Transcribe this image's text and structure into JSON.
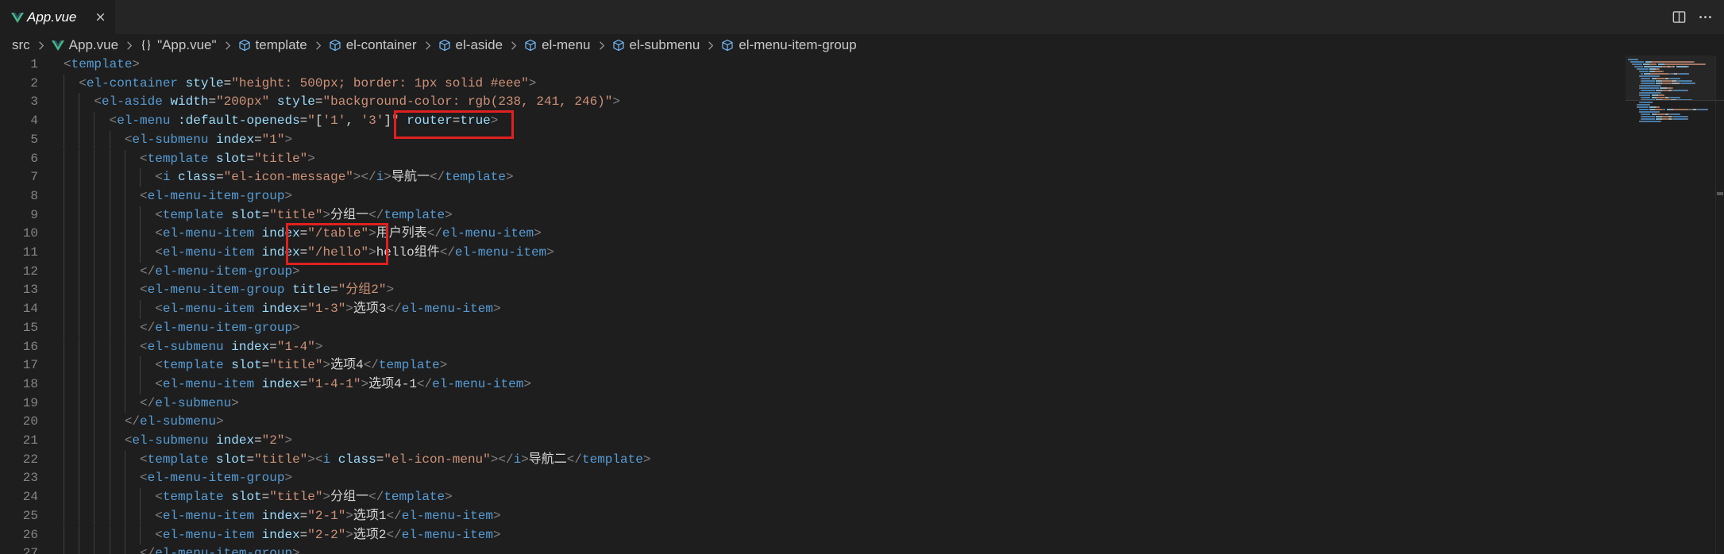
{
  "tabs": [
    {
      "label": "App.vue",
      "icon": "vue-icon"
    }
  ],
  "tab_actions": {
    "close_icon": "close-icon",
    "split_icon": "split-editor-icon",
    "more_icon": "more-actions-icon"
  },
  "breadcrumb_separator_icon": "chevron-right-icon",
  "breadcrumbs": [
    {
      "label": "src"
    },
    {
      "label": "App.vue",
      "icon": "vue-icon"
    },
    {
      "label": "\"App.vue\"",
      "icon": "braces-icon"
    },
    {
      "label": "template",
      "icon": "element-icon"
    },
    {
      "label": "el-container",
      "icon": "element-icon"
    },
    {
      "label": "el-aside",
      "icon": "element-icon"
    },
    {
      "label": "el-menu",
      "icon": "element-icon"
    },
    {
      "label": "el-submenu",
      "icon": "element-icon"
    },
    {
      "label": "el-menu-item-group",
      "icon": "element-icon"
    }
  ],
  "colors": {
    "editor_background": "#1e1e1e",
    "punctuation": "#808080",
    "tag": "#569cd6",
    "attribute": "#9cdcfe",
    "string": "#ce9178",
    "text": "#d4d4d4",
    "line_number": "#858585",
    "annotation": "#e02020",
    "vue_green": "#41b883",
    "element_icon": "#75beff"
  },
  "editor": {
    "lines": [
      {
        "number": "1",
        "tokens": [
          [
            "<",
            "punct"
          ],
          [
            "template",
            "tag"
          ],
          [
            ">",
            "punct"
          ]
        ]
      },
      {
        "number": "2",
        "tokens": [
          [
            "  ",
            "indent"
          ],
          [
            "<",
            "punct"
          ],
          [
            "el-container",
            "tag"
          ],
          [
            " ",
            "text"
          ],
          [
            "style",
            "attr"
          ],
          [
            "=",
            "text"
          ],
          [
            "\"height: 500px; border: 1px solid #eee\"",
            "str"
          ],
          [
            ">",
            "punct"
          ]
        ]
      },
      {
        "number": "3",
        "tokens": [
          [
            "    ",
            "indent"
          ],
          [
            "<",
            "punct"
          ],
          [
            "el-aside",
            "tag"
          ],
          [
            " ",
            "text"
          ],
          [
            "width",
            "attr"
          ],
          [
            "=",
            "text"
          ],
          [
            "\"200px\"",
            "str"
          ],
          [
            " ",
            "text"
          ],
          [
            "style",
            "attr"
          ],
          [
            "=",
            "text"
          ],
          [
            "\"background-color: rgb(238, 241, 246)\"",
            "str"
          ],
          [
            ">",
            "punct"
          ]
        ]
      },
      {
        "number": "4",
        "tokens": [
          [
            "      ",
            "indent"
          ],
          [
            "<",
            "punct"
          ],
          [
            "el-menu",
            "tag"
          ],
          [
            " ",
            "text"
          ],
          [
            ":default-openeds",
            "attr"
          ],
          [
            "=",
            "text"
          ],
          [
            "\"",
            "str"
          ],
          [
            "[",
            "text"
          ],
          [
            "'1'",
            "str"
          ],
          [
            ", ",
            "text"
          ],
          [
            "'3'",
            "str"
          ],
          [
            "]",
            "text"
          ],
          [
            "\"",
            "str"
          ],
          [
            " ",
            "text"
          ],
          [
            "router",
            "attr"
          ],
          [
            "=",
            "text"
          ],
          [
            "true",
            "attr"
          ],
          [
            ">",
            "punct"
          ]
        ]
      },
      {
        "number": "5",
        "tokens": [
          [
            "        ",
            "indent"
          ],
          [
            "<",
            "punct"
          ],
          [
            "el-submenu",
            "tag"
          ],
          [
            " ",
            "text"
          ],
          [
            "index",
            "attr"
          ],
          [
            "=",
            "text"
          ],
          [
            "\"1\"",
            "str"
          ],
          [
            ">",
            "punct"
          ]
        ]
      },
      {
        "number": "6",
        "tokens": [
          [
            "          ",
            "indent"
          ],
          [
            "<",
            "punct"
          ],
          [
            "template",
            "tag"
          ],
          [
            " ",
            "text"
          ],
          [
            "slot",
            "attr"
          ],
          [
            "=",
            "text"
          ],
          [
            "\"title\"",
            "str"
          ],
          [
            ">",
            "punct"
          ]
        ]
      },
      {
        "number": "7",
        "tokens": [
          [
            "            ",
            "indent"
          ],
          [
            "<",
            "punct"
          ],
          [
            "i",
            "tag"
          ],
          [
            " ",
            "text"
          ],
          [
            "class",
            "attr"
          ],
          [
            "=",
            "text"
          ],
          [
            "\"el-icon-message\"",
            "str"
          ],
          [
            "></",
            "punct"
          ],
          [
            "i",
            "tag"
          ],
          [
            ">",
            "punct"
          ],
          [
            "导航一",
            "text"
          ],
          [
            "</",
            "punct"
          ],
          [
            "template",
            "tag"
          ],
          [
            ">",
            "punct"
          ]
        ]
      },
      {
        "number": "8",
        "tokens": [
          [
            "          ",
            "indent"
          ],
          [
            "<",
            "punct"
          ],
          [
            "el-menu-item-group",
            "tag"
          ],
          [
            ">",
            "punct"
          ]
        ]
      },
      {
        "number": "9",
        "tokens": [
          [
            "            ",
            "indent"
          ],
          [
            "<",
            "punct"
          ],
          [
            "template",
            "tag"
          ],
          [
            " ",
            "text"
          ],
          [
            "slot",
            "attr"
          ],
          [
            "=",
            "text"
          ],
          [
            "\"title\"",
            "str"
          ],
          [
            ">",
            "punct"
          ],
          [
            "分组一",
            "text"
          ],
          [
            "</",
            "punct"
          ],
          [
            "template",
            "tag"
          ],
          [
            ">",
            "punct"
          ]
        ]
      },
      {
        "number": "10",
        "tokens": [
          [
            "            ",
            "indent"
          ],
          [
            "<",
            "punct"
          ],
          [
            "el-menu-item",
            "tag"
          ],
          [
            " ",
            "text"
          ],
          [
            "index",
            "attr"
          ],
          [
            "=",
            "text"
          ],
          [
            "\"/table\"",
            "str"
          ],
          [
            ">",
            "punct"
          ],
          [
            "用户列表",
            "text"
          ],
          [
            "</",
            "punct"
          ],
          [
            "el-menu-item",
            "tag"
          ],
          [
            ">",
            "punct"
          ]
        ]
      },
      {
        "number": "11",
        "tokens": [
          [
            "            ",
            "indent"
          ],
          [
            "<",
            "punct"
          ],
          [
            "el-menu-item",
            "tag"
          ],
          [
            " ",
            "text"
          ],
          [
            "index",
            "attr"
          ],
          [
            "=",
            "text"
          ],
          [
            "\"/hello\"",
            "str"
          ],
          [
            ">",
            "punct"
          ],
          [
            "hello组件",
            "text"
          ],
          [
            "</",
            "punct"
          ],
          [
            "el-menu-item",
            "tag"
          ],
          [
            ">",
            "punct"
          ]
        ]
      },
      {
        "number": "12",
        "tokens": [
          [
            "          ",
            "indent"
          ],
          [
            "</",
            "punct"
          ],
          [
            "el-menu-item-group",
            "tag"
          ],
          [
            ">",
            "punct"
          ]
        ]
      },
      {
        "number": "13",
        "tokens": [
          [
            "          ",
            "indent"
          ],
          [
            "<",
            "punct"
          ],
          [
            "el-menu-item-group",
            "tag"
          ],
          [
            " ",
            "text"
          ],
          [
            "title",
            "attr"
          ],
          [
            "=",
            "text"
          ],
          [
            "\"分组2\"",
            "str"
          ],
          [
            ">",
            "punct"
          ]
        ]
      },
      {
        "number": "14",
        "tokens": [
          [
            "            ",
            "indent"
          ],
          [
            "<",
            "punct"
          ],
          [
            "el-menu-item",
            "tag"
          ],
          [
            " ",
            "text"
          ],
          [
            "index",
            "attr"
          ],
          [
            "=",
            "text"
          ],
          [
            "\"1-3\"",
            "str"
          ],
          [
            ">",
            "punct"
          ],
          [
            "选项3",
            "text"
          ],
          [
            "</",
            "punct"
          ],
          [
            "el-menu-item",
            "tag"
          ],
          [
            ">",
            "punct"
          ]
        ]
      },
      {
        "number": "15",
        "tokens": [
          [
            "          ",
            "indent"
          ],
          [
            "</",
            "punct"
          ],
          [
            "el-menu-item-group",
            "tag"
          ],
          [
            ">",
            "punct"
          ]
        ]
      },
      {
        "number": "16",
        "tokens": [
          [
            "          ",
            "indent"
          ],
          [
            "<",
            "punct"
          ],
          [
            "el-submenu",
            "tag"
          ],
          [
            " ",
            "text"
          ],
          [
            "index",
            "attr"
          ],
          [
            "=",
            "text"
          ],
          [
            "\"1-4\"",
            "str"
          ],
          [
            ">",
            "punct"
          ]
        ]
      },
      {
        "number": "17",
        "tokens": [
          [
            "            ",
            "indent"
          ],
          [
            "<",
            "punct"
          ],
          [
            "template",
            "tag"
          ],
          [
            " ",
            "text"
          ],
          [
            "slot",
            "attr"
          ],
          [
            "=",
            "text"
          ],
          [
            "\"title\"",
            "str"
          ],
          [
            ">",
            "punct"
          ],
          [
            "选项4",
            "text"
          ],
          [
            "</",
            "punct"
          ],
          [
            "template",
            "tag"
          ],
          [
            ">",
            "punct"
          ]
        ]
      },
      {
        "number": "18",
        "tokens": [
          [
            "            ",
            "indent"
          ],
          [
            "<",
            "punct"
          ],
          [
            "el-menu-item",
            "tag"
          ],
          [
            " ",
            "text"
          ],
          [
            "index",
            "attr"
          ],
          [
            "=",
            "text"
          ],
          [
            "\"1-4-1\"",
            "str"
          ],
          [
            ">",
            "punct"
          ],
          [
            "选项4-1",
            "text"
          ],
          [
            "</",
            "punct"
          ],
          [
            "el-menu-item",
            "tag"
          ],
          [
            ">",
            "punct"
          ]
        ]
      },
      {
        "number": "19",
        "tokens": [
          [
            "          ",
            "indent"
          ],
          [
            "</",
            "punct"
          ],
          [
            "el-submenu",
            "tag"
          ],
          [
            ">",
            "punct"
          ]
        ]
      },
      {
        "number": "20",
        "tokens": [
          [
            "        ",
            "indent"
          ],
          [
            "</",
            "punct"
          ],
          [
            "el-submenu",
            "tag"
          ],
          [
            ">",
            "punct"
          ]
        ]
      },
      {
        "number": "21",
        "tokens": [
          [
            "        ",
            "indent"
          ],
          [
            "<",
            "punct"
          ],
          [
            "el-submenu",
            "tag"
          ],
          [
            " ",
            "text"
          ],
          [
            "index",
            "attr"
          ],
          [
            "=",
            "text"
          ],
          [
            "\"2\"",
            "str"
          ],
          [
            ">",
            "punct"
          ]
        ]
      },
      {
        "number": "22",
        "tokens": [
          [
            "          ",
            "indent"
          ],
          [
            "<",
            "punct"
          ],
          [
            "template",
            "tag"
          ],
          [
            " ",
            "text"
          ],
          [
            "slot",
            "attr"
          ],
          [
            "=",
            "text"
          ],
          [
            "\"title\"",
            "str"
          ],
          [
            "><",
            "punct"
          ],
          [
            "i",
            "tag"
          ],
          [
            " ",
            "text"
          ],
          [
            "class",
            "attr"
          ],
          [
            "=",
            "text"
          ],
          [
            "\"el-icon-menu\"",
            "str"
          ],
          [
            "></",
            "punct"
          ],
          [
            "i",
            "tag"
          ],
          [
            ">",
            "punct"
          ],
          [
            "导航二",
            "text"
          ],
          [
            "</",
            "punct"
          ],
          [
            "template",
            "tag"
          ],
          [
            ">",
            "punct"
          ]
        ]
      },
      {
        "number": "23",
        "tokens": [
          [
            "          ",
            "indent"
          ],
          [
            "<",
            "punct"
          ],
          [
            "el-menu-item-group",
            "tag"
          ],
          [
            ">",
            "punct"
          ]
        ]
      },
      {
        "number": "24",
        "tokens": [
          [
            "            ",
            "indent"
          ],
          [
            "<",
            "punct"
          ],
          [
            "template",
            "tag"
          ],
          [
            " ",
            "text"
          ],
          [
            "slot",
            "attr"
          ],
          [
            "=",
            "text"
          ],
          [
            "\"title\"",
            "str"
          ],
          [
            ">",
            "punct"
          ],
          [
            "分组一",
            "text"
          ],
          [
            "</",
            "punct"
          ],
          [
            "template",
            "tag"
          ],
          [
            ">",
            "punct"
          ]
        ]
      },
      {
        "number": "25",
        "tokens": [
          [
            "            ",
            "indent"
          ],
          [
            "<",
            "punct"
          ],
          [
            "el-menu-item",
            "tag"
          ],
          [
            " ",
            "text"
          ],
          [
            "index",
            "attr"
          ],
          [
            "=",
            "text"
          ],
          [
            "\"2-1\"",
            "str"
          ],
          [
            ">",
            "punct"
          ],
          [
            "选项1",
            "text"
          ],
          [
            "</",
            "punct"
          ],
          [
            "el-menu-item",
            "tag"
          ],
          [
            ">",
            "punct"
          ]
        ]
      },
      {
        "number": "26",
        "tokens": [
          [
            "            ",
            "indent"
          ],
          [
            "<",
            "punct"
          ],
          [
            "el-menu-item",
            "tag"
          ],
          [
            " ",
            "text"
          ],
          [
            "index",
            "attr"
          ],
          [
            "=",
            "text"
          ],
          [
            "\"2-2\"",
            "str"
          ],
          [
            ">",
            "punct"
          ],
          [
            "选项2",
            "text"
          ],
          [
            "</",
            "punct"
          ],
          [
            "el-menu-item",
            "tag"
          ],
          [
            ">",
            "punct"
          ]
        ]
      },
      {
        "number": "27",
        "tokens": [
          [
            "          ",
            "indent"
          ],
          [
            "</",
            "punct"
          ],
          [
            "el-menu-item-group",
            "tag"
          ],
          [
            ">",
            "punct"
          ]
        ]
      }
    ]
  }
}
